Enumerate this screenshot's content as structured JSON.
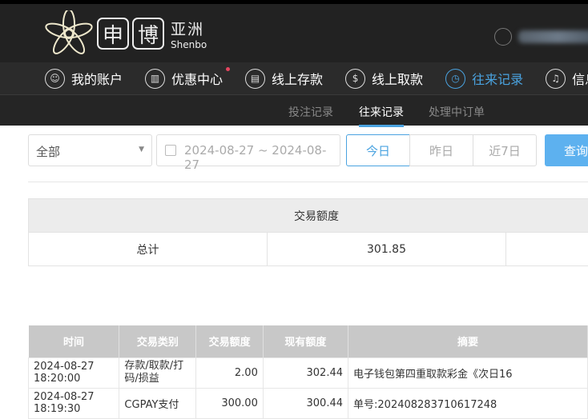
{
  "brand": {
    "char1": "申",
    "char2": "博",
    "cn": "亚洲",
    "en": "Shenbo"
  },
  "nav": [
    {
      "label": "我的账户",
      "icon": "user-icon"
    },
    {
      "label": "优惠中心",
      "icon": "gift-icon"
    },
    {
      "label": "线上存款",
      "icon": "deposit-icon"
    },
    {
      "label": "线上取款",
      "icon": "withdraw-icon"
    },
    {
      "label": "往来记录",
      "icon": "records-icon",
      "active": true
    },
    {
      "label": "信息",
      "icon": "bell-icon"
    }
  ],
  "subnav": [
    "投注记录",
    "往来记录",
    "处理中订单"
  ],
  "filters": {
    "type": "全部",
    "date_range": "2024-08-27 ~ 2024-08-27",
    "today": "今日",
    "yesterday": "昨日",
    "last7": "近7日",
    "search": "查询"
  },
  "summary": {
    "header": "交易额度",
    "label": "总计",
    "value": "301.85"
  },
  "table": {
    "headers": [
      "时间",
      "交易类别",
      "交易额度",
      "现有额度",
      "摘要"
    ],
    "rows": [
      [
        "2024-08-27 18:20:00",
        "存款/取款/打码/损益",
        "2.00",
        "302.44",
        "电子钱包第四重取款彩金《次日16"
      ],
      [
        "2024-08-27 18:19:30",
        "CGPAY支付",
        "300.00",
        "300.44",
        "单号:202408283710617248"
      ]
    ]
  },
  "colors": {
    "accent": "#4aa3e0",
    "header_bg": "#222222",
    "badge": "#e5455f"
  }
}
